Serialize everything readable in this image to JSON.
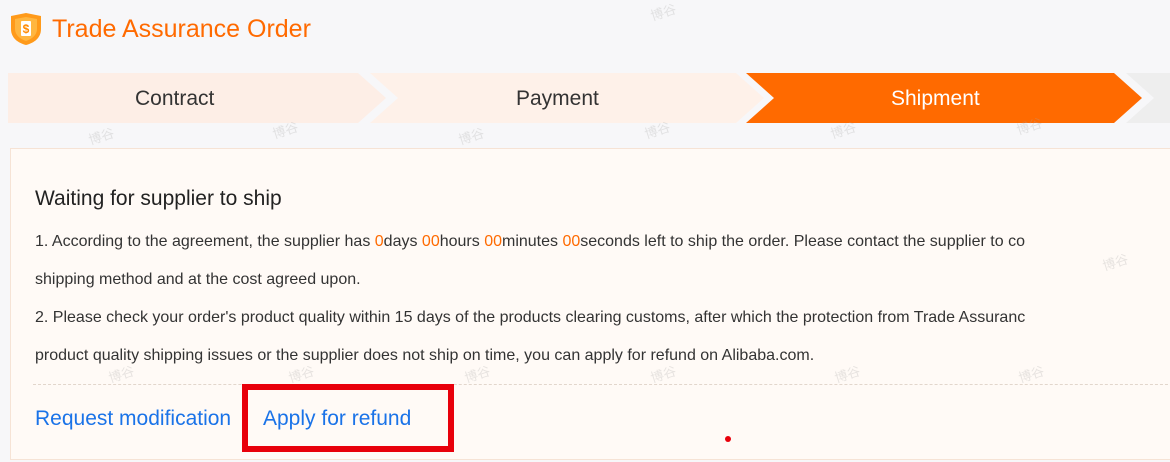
{
  "header": {
    "title": "Trade Assurance Order",
    "icon": "shield-dollar-icon",
    "accent_color": "#ff6a00"
  },
  "steps": [
    {
      "label": "Contract",
      "active": false
    },
    {
      "label": "Payment",
      "active": false
    },
    {
      "label": "Shipment",
      "active": true
    }
  ],
  "panel": {
    "title": "Waiting for supplier to ship",
    "line1": {
      "prefix": "1. According to the agreement, the supplier has ",
      "days_value": "0",
      "days_label": "days ",
      "hours_value": "00",
      "hours_label": "hours ",
      "minutes_value": "00",
      "minutes_label": "minutes ",
      "seconds_value": "00",
      "seconds_label": "seconds left to ship the order. Please contact the supplier to co"
    },
    "line2": "shipping method and at the cost agreed upon.",
    "line3": "2. Please check your order's product quality within 15 days of the products clearing customs, after which the protection from Trade Assuranc",
    "line4": "product quality shipping issues or the supplier does not ship on time, you can apply for refund on Alibaba.com."
  },
  "actions": {
    "request_modification": "Request modification",
    "apply_for_refund": "Apply for refund"
  },
  "watermark_text": "博谷",
  "colors": {
    "link": "#1a73e8",
    "active_step": "#ff6a00",
    "inactive_step": "#fdeee6",
    "highlight": "#e8000b"
  }
}
